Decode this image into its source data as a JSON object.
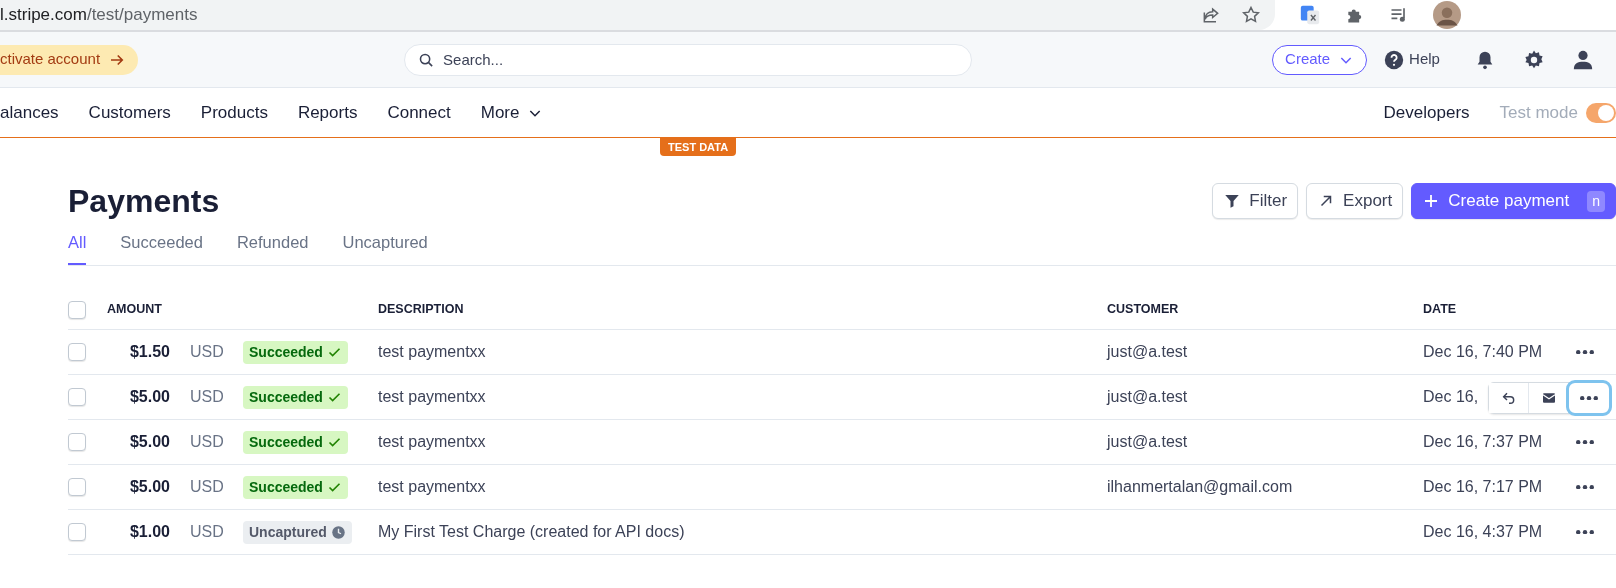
{
  "browser": {
    "url_host": "l.stripe.com",
    "url_path": "/test/payments"
  },
  "topbar": {
    "activate": "ctivate account",
    "search_placeholder": "Search...",
    "create": "Create",
    "help": "Help"
  },
  "nav": {
    "items": [
      {
        "label": "alances",
        "kind": "link"
      },
      {
        "label": "Customers",
        "kind": "link"
      },
      {
        "label": "Products",
        "kind": "link"
      },
      {
        "label": "Reports",
        "kind": "link"
      },
      {
        "label": "Connect",
        "kind": "link"
      },
      {
        "label": "More",
        "kind": "dropdown"
      }
    ],
    "developers": "Developers",
    "test_mode": {
      "label": "Test mode",
      "on": true
    }
  },
  "test_badge": "TEST DATA",
  "page": {
    "title": "Payments",
    "buttons": [
      {
        "label": "Filter",
        "kind": "filter"
      },
      {
        "label": "Export",
        "kind": "export"
      },
      {
        "label": "Create payment",
        "kind": "primary",
        "shortcut": "n"
      }
    ]
  },
  "tabs": [
    {
      "label": "All",
      "selected": true
    },
    {
      "label": "Succeeded",
      "selected": false
    },
    {
      "label": "Refunded",
      "selected": false
    },
    {
      "label": "Uncaptured",
      "selected": false
    }
  ],
  "table": {
    "header_checked": false,
    "columns": [
      "AMOUNT",
      "DESCRIPTION",
      "CUSTOMER",
      "DATE"
    ],
    "rows": [
      {
        "checked": false,
        "amount": "$1.50",
        "currency": "USD",
        "status": {
          "label": "Succeeded",
          "kind": "succeeded"
        },
        "description": "test paymentxx",
        "customer": "just@a.test",
        "date": "Dec 16, 7:40 PM",
        "hovered": false
      },
      {
        "checked": false,
        "amount": "$5.00",
        "currency": "USD",
        "status": {
          "label": "Succeeded",
          "kind": "succeeded"
        },
        "description": "test paymentxx",
        "customer": "just@a.test",
        "date": "Dec 16,",
        "hovered": true
      },
      {
        "checked": false,
        "amount": "$5.00",
        "currency": "USD",
        "status": {
          "label": "Succeeded",
          "kind": "succeeded"
        },
        "description": "test paymentxx",
        "customer": "just@a.test",
        "date": "Dec 16, 7:37 PM",
        "hovered": false
      },
      {
        "checked": false,
        "amount": "$5.00",
        "currency": "USD",
        "status": {
          "label": "Succeeded",
          "kind": "succeeded"
        },
        "description": "test paymentxx",
        "customer": "ilhanmertalan@gmail.com",
        "date": "Dec 16, 7:17 PM",
        "hovered": false
      },
      {
        "checked": false,
        "amount": "$1.00",
        "currency": "USD",
        "status": {
          "label": "Uncaptured",
          "kind": "uncaptured"
        },
        "description": "My First Test Charge (created for API docs)",
        "date": "Dec 16, 4:37 PM",
        "hovered": false
      }
    ]
  }
}
